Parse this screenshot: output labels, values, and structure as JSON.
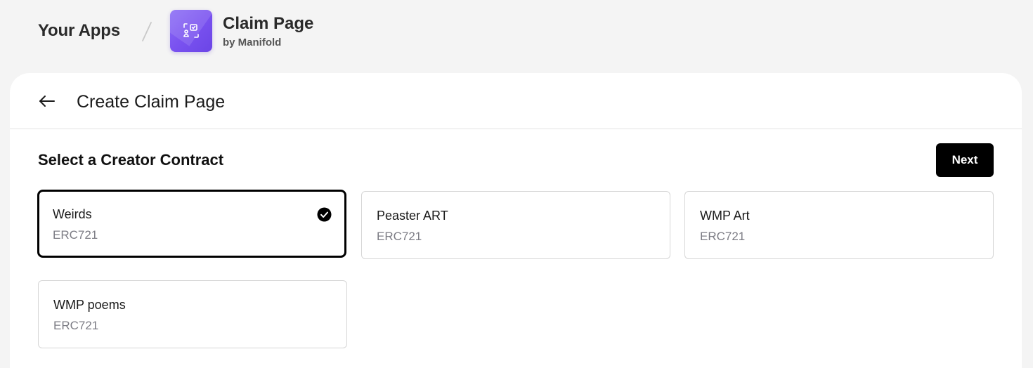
{
  "breadcrumb": {
    "root_label": "Your Apps",
    "app_title": "Claim Page",
    "app_subtitle": "by Manifold"
  },
  "panel": {
    "title": "Create Claim Page",
    "section_title": "Select a Creator Contract",
    "next_label": "Next"
  },
  "contracts": [
    {
      "name": "Weirds",
      "type": "ERC721",
      "selected": true
    },
    {
      "name": "Peaster ART",
      "type": "ERC721",
      "selected": false
    },
    {
      "name": "WMP Art",
      "type": "ERC721",
      "selected": false
    },
    {
      "name": "WMP poems",
      "type": "ERC721",
      "selected": false
    }
  ],
  "icons": {
    "app": "claim-page-icon",
    "back": "arrow-left-icon",
    "selected": "check-circle-icon"
  },
  "colors": {
    "accent": "#7a52f0",
    "primary_button": "#000000",
    "background": "#f4f4f4"
  }
}
